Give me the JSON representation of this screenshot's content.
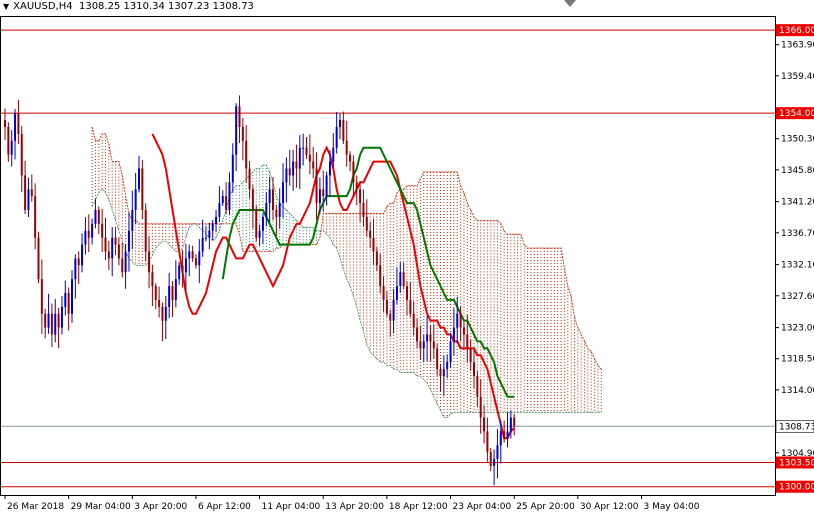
{
  "header": {
    "symbol": "XAUUSD,H4",
    "ohlc": "1308.25 1310.34 1307.23 1308.73"
  },
  "colors": {
    "background": "#ffffff",
    "candle_bull": "#0000cc",
    "candle_bear": "#990000",
    "tenkan": "#ee0000",
    "kijun": "#007700",
    "kumo_bull": "#2e8b57",
    "kumo_bear": "#cc2200",
    "hline": "#cc0000",
    "bid_line": "#889999",
    "bid_label_bg": "#ffffff",
    "level_label_bg": "#ee0000"
  },
  "chart_data": {
    "type": "candlestick",
    "ylim": [
      1298.8,
      1367.9
    ],
    "y_ticks": [
      "1363.90",
      "1359.40",
      "1350.30",
      "1345.80",
      "1341.20",
      "1336.70",
      "1332.10",
      "1327.60",
      "1323.00",
      "1318.50",
      "1314.00",
      "1304.90"
    ],
    "x_ticks": [
      {
        "label": "26 Mar 2018",
        "index": 0
      },
      {
        "label": "29 Mar 04:00",
        "index": 19
      },
      {
        "label": "3 Apr 20:00",
        "index": 38
      },
      {
        "label": "6 Apr 12:00",
        "index": 57
      },
      {
        "label": "11 Apr 04:00",
        "index": 76
      },
      {
        "label": "13 Apr 20:00",
        "index": 95
      },
      {
        "label": "18 Apr 12:00",
        "index": 114
      },
      {
        "label": "23 Apr 04:00",
        "index": 133
      },
      {
        "label": "25 Apr 20:00",
        "index": 152
      },
      {
        "label": "30 Apr 12:00",
        "index": 171
      },
      {
        "label": "3 May 04:00",
        "index": 190
      }
    ],
    "horizontal_levels": [
      {
        "label": "1366.00",
        "value": 1366.0
      },
      {
        "label": "1354.00",
        "value": 1354.0
      },
      {
        "label": "1303.50",
        "value": 1303.5
      },
      {
        "label": "1300.00",
        "value": 1300.0
      }
    ],
    "current_price": {
      "label": "1308.73",
      "value": 1308.73
    },
    "candles_close": [
      1352,
      1348,
      1350,
      1354,
      1351,
      1345,
      1340,
      1343,
      1342,
      1336,
      1330,
      1325,
      1323,
      1325,
      1322,
      1325,
      1323,
      1326,
      1328,
      1325,
      1330,
      1333,
      1332,
      1335,
      1337,
      1336,
      1338,
      1340,
      1338,
      1336,
      1334,
      1333,
      1336,
      1335,
      1333,
      1331,
      1334,
      1337,
      1340,
      1343,
      1346,
      1340,
      1334,
      1331,
      1329,
      1327,
      1326,
      1324,
      1326,
      1329,
      1327,
      1330,
      1332,
      1331,
      1333,
      1334,
      1333,
      1332,
      1334,
      1336,
      1336,
      1337,
      1338,
      1339,
      1341,
      1342,
      1340,
      1344,
      1348,
      1355,
      1352,
      1350,
      1346,
      1343,
      1340,
      1336,
      1337,
      1339,
      1341,
      1343,
      1340,
      1339,
      1341,
      1344,
      1346,
      1345,
      1347,
      1346,
      1349,
      1349,
      1348,
      1347,
      1346,
      1341,
      1343,
      1342,
      1345,
      1347,
      1349,
      1352,
      1353,
      1350,
      1348,
      1347,
      1344,
      1343,
      1341,
      1339,
      1337,
      1336,
      1334,
      1332,
      1329,
      1327,
      1325,
      1324,
      1327,
      1329,
      1331,
      1329,
      1327,
      1325,
      1323,
      1321,
      1320,
      1321,
      1322,
      1321,
      1320,
      1317,
      1316,
      1317,
      1318,
      1321,
      1323,
      1325,
      1323,
      1322,
      1320,
      1318,
      1316,
      1313,
      1310,
      1308,
      1305,
      1303,
      1304,
      1306,
      1308,
      1307,
      1308,
      1310,
      1308.73
    ],
    "tenkan": [
      1351,
      1350,
      1349,
      1348,
      1346,
      1343,
      1340,
      1337,
      1334,
      1331,
      1328,
      1326,
      1325,
      1325,
      1326,
      1327,
      1328,
      1330,
      1332,
      1334,
      1335,
      1336,
      1336,
      1335,
      1334,
      1333,
      1333,
      1333,
      1334,
      1335,
      1335,
      1334,
      1333,
      1332,
      1331,
      1330,
      1329,
      1330,
      1331,
      1332,
      1334,
      1336,
      1337,
      1338,
      1338,
      1339,
      1340,
      1341,
      1343,
      1345,
      1346,
      1348,
      1349,
      1348,
      1346,
      1343,
      1341,
      1340,
      1340,
      1341,
      1342,
      1343,
      1344,
      1344,
      1345,
      1346,
      1347,
      1347,
      1347,
      1347,
      1347,
      1347,
      1346,
      1345,
      1343,
      1341,
      1339,
      1337,
      1335,
      1332,
      1329,
      1327,
      1325,
      1324,
      1324,
      1324,
      1323,
      1323,
      1322,
      1322,
      1321,
      1321,
      1320,
      1320,
      1320,
      1320,
      1320,
      1319,
      1319,
      1318,
      1317,
      1315,
      1313,
      1311,
      1309,
      1307,
      1307,
      1308,
      1308.5
    ],
    "kijun": [
      1330,
      1333,
      1336,
      1338,
      1339,
      1340,
      1340,
      1340,
      1340,
      1340,
      1340,
      1340,
      1340,
      1339,
      1338,
      1337,
      1336,
      1335,
      1335,
      1335,
      1335,
      1335,
      1335,
      1335,
      1335,
      1335,
      1335,
      1336,
      1338,
      1340,
      1341,
      1342,
      1342,
      1342,
      1342,
      1342,
      1342,
      1342,
      1343,
      1345,
      1346,
      1348,
      1349,
      1349,
      1349,
      1349,
      1349,
      1349,
      1348,
      1347,
      1346,
      1345,
      1344,
      1343,
      1342,
      1341,
      1341,
      1341,
      1340,
      1338,
      1336,
      1334,
      1332,
      1331,
      1330,
      1329,
      1328,
      1327,
      1327,
      1327,
      1326,
      1325,
      1324,
      1324,
      1323,
      1322,
      1321,
      1321,
      1320,
      1320,
      1319,
      1318,
      1316,
      1315,
      1314,
      1313,
      1313,
      1313
    ]
  }
}
